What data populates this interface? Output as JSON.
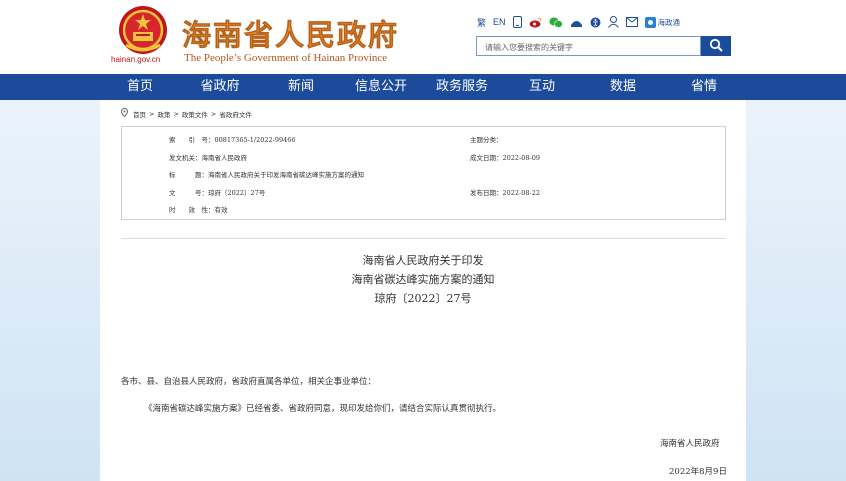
{
  "header": {
    "domain": "hainan.gov.cn",
    "brand_cn": "海南省人民政府",
    "brand_en": "The People’s Government  of Hainan Province",
    "toolbar": {
      "traditional": "繁",
      "english": "EN",
      "haizhengtong": "海政通"
    },
    "search_placeholder": "请输入您要搜索的关键字"
  },
  "nav": [
    "首页",
    "省政府",
    "新闻",
    "信息公开",
    "政务服务",
    "互动",
    "数据",
    "省情"
  ],
  "breadcrumb": [
    "首页",
    "政策",
    "政策文件",
    "省政府文件"
  ],
  "meta": {
    "index_label": "索　　引　号：",
    "index_value": "00817365-1/2022-99466",
    "category_label": "主题分类：",
    "category_value": "",
    "issuer_label": "发文机关：",
    "issuer_value": "海南省人民政府",
    "date_label": "成文日期：",
    "date_value": "2022-08-09",
    "subject_label": "标　　　题：",
    "subject_value": "海南省人民政府关于印发海南省碳达峰实施方案的通知",
    "docno_label": "文　　　号：",
    "docno_value": "琼府〔2022〕27号",
    "pubdate_label": "发布日期：",
    "pubdate_value": "2022-08-22",
    "validity_label": "时　　效　性：",
    "validity_value": "有效"
  },
  "article": {
    "title_line1": "海南省人民政府关于印发",
    "title_line2": "海南省碳达峰实施方案的通知",
    "doc_number": "琼府〔2022〕27号",
    "salutation": "各市、县、自治县人民政府，省政府直属各单位，相关企事业单位：",
    "paragraph": "《海南省碳达峰实施方案》已经省委、省政府同意，现印发给你们，请结合实际认真贯彻执行。",
    "signer": "海南省人民政府",
    "sign_date": "2022年8月9日"
  },
  "colors": {
    "nav_blue": "#1d4b9b",
    "brand_orange": "#e8942a",
    "emblem_red": "#c0161b"
  }
}
